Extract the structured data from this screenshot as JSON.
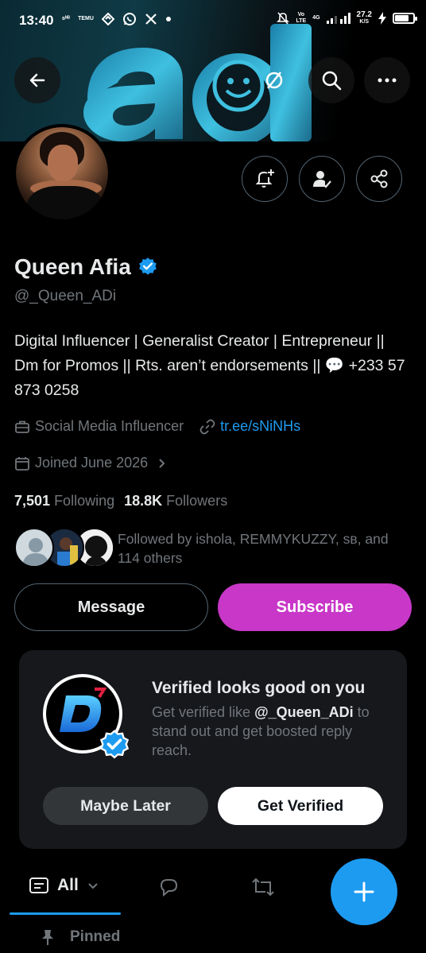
{
  "status_bar": {
    "time": "13:40",
    "left_icons": [
      "sim-icon",
      "temu-icon",
      "vpn-icon",
      "whatsapp-icon",
      "x-icon",
      "dot-icon"
    ],
    "left_small_text_1": "ᵴᴺᴮ",
    "left_small_text_2": "TEMU",
    "vo_lte": "Vo\nLTE",
    "net_type": "4G",
    "speed_value": "27.2",
    "speed_unit": "K/S",
    "battery_level": 0.75
  },
  "profile": {
    "name": "Queen Afia",
    "handle": "@_Queen_ADi",
    "bio": "Digital Influencer | Generalist Creator | Entrepreneur || Dm for Promos || Rts. aren’t endorsements || 💬 +233 57 873 0258",
    "category": "Social Media Influencer",
    "link": "tr.ee/sNiNHs",
    "joined": "Joined June 2026",
    "following_count": "7,501",
    "following_label": "Following",
    "followers_count": "18.8K",
    "followers_label": "Followers",
    "followed_by": "Followed by ishola, REMMYKUZZY, sʙ, and 114 others"
  },
  "buttons": {
    "message": "Message",
    "subscribe": "Subscribe"
  },
  "verified_card": {
    "title": "Verified looks good on you",
    "desc_pre": "Get verified like ",
    "desc_handle": "@_Queen_ADi",
    "desc_post": " to stand out and get boosted reply reach.",
    "maybe_later": "Maybe Later",
    "get_verified": "Get Verified"
  },
  "tabs": {
    "all": "All"
  },
  "pinned": "Pinned",
  "colors": {
    "accent": "#1d9bf0",
    "subscribe": "#c837c8",
    "muted": "#71767b",
    "card": "#16181c"
  }
}
